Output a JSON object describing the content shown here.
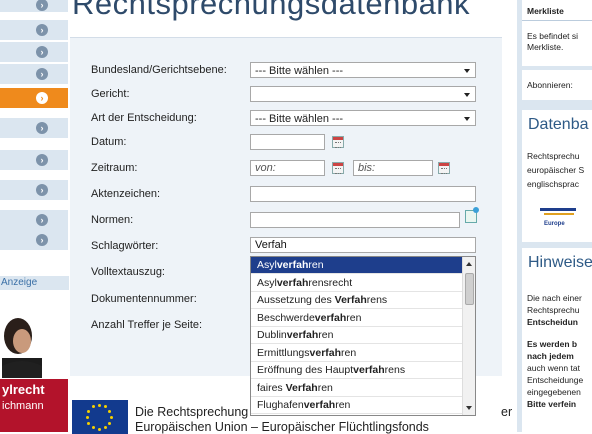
{
  "header": {
    "title": "Rechtsprechungsdatenbank"
  },
  "leftnav": {
    "items": [
      {
        "active": false
      },
      {
        "active": false
      },
      {
        "active": false
      },
      {
        "active": true
      },
      {
        "active": false
      },
      {
        "active": false
      },
      {
        "active": false
      },
      {
        "active": false
      }
    ],
    "anzeige": "Anzeige",
    "ad_title": "ylrecht",
    "ad_sub": "ichmann"
  },
  "form": {
    "bundesland": {
      "label": "Bundesland/Gerichtsebene:",
      "value": "--- Bitte wählen ---"
    },
    "gericht": {
      "label": "Gericht:",
      "value": ""
    },
    "art": {
      "label": "Art der Entscheidung:",
      "value": "--- Bitte wählen ---"
    },
    "datum": {
      "label": "Datum:"
    },
    "zeitraum": {
      "label": "Zeitraum:",
      "von": "von:",
      "bis": "bis:"
    },
    "aktenzeichen": {
      "label": "Aktenzeichen:"
    },
    "normen": {
      "label": "Normen:"
    },
    "schlagwoerter": {
      "label": "Schlagwörter:",
      "value": "Verfah"
    },
    "volltext": {
      "label": "Volltextauszug:"
    },
    "dokumentennummer": {
      "label": "Dokumentennummer:"
    },
    "anzahl": {
      "label": "Anzahl Treffer je Seite:"
    }
  },
  "autocomplete": {
    "items": [
      {
        "pre": "Asyl",
        "bold": "verfah",
        "post": "ren"
      },
      {
        "pre": "Asyl",
        "bold": "verfah",
        "post": "rensrecht"
      },
      {
        "pre": "Aussetzung des ",
        "bold": "Verfah",
        "post": "rens"
      },
      {
        "pre": "Beschwerde",
        "bold": "verfah",
        "post": "ren"
      },
      {
        "pre": "Dublin",
        "bold": "verfah",
        "post": "ren"
      },
      {
        "pre": "Ermittlungs",
        "bold": "verfah",
        "post": "ren"
      },
      {
        "pre": "Eröffnung des Haupt",
        "bold": "verfah",
        "post": "rens"
      },
      {
        "pre": "faires ",
        "bold": "Verfah",
        "post": "ren"
      },
      {
        "pre": "Flughafen",
        "bold": "verfah",
        "post": "ren"
      }
    ]
  },
  "footer": {
    "line1": "Die Rechtsprechung",
    "line1_tail": "er",
    "line2": "Europäischen Union – Europäischer Flüchtlingsfonds"
  },
  "right": {
    "merkliste_head": "Merkliste",
    "merkliste_text1": "Es befindet si",
    "merkliste_text2": "Merkliste.",
    "abonnieren": "Abonnieren:",
    "datenbank_head": "Datenba",
    "datenbank_l1": "Rechtsprechu",
    "datenbank_l2": "europäischer S",
    "datenbank_l3": "englischsprac",
    "europe_logo": "Europe",
    "hinweise_head": "Hinweise",
    "h_l1": "Die nach einer",
    "h_l2": "Rechtsprechu",
    "h_l3": "Entscheidun",
    "h_l4": "Es werden b",
    "h_l5": "nach jedem",
    "h_l6": "auch wenn tat",
    "h_l7": "Entscheidunge",
    "h_l8": "eingegebenen",
    "h_l9": "Bitte verfein"
  }
}
